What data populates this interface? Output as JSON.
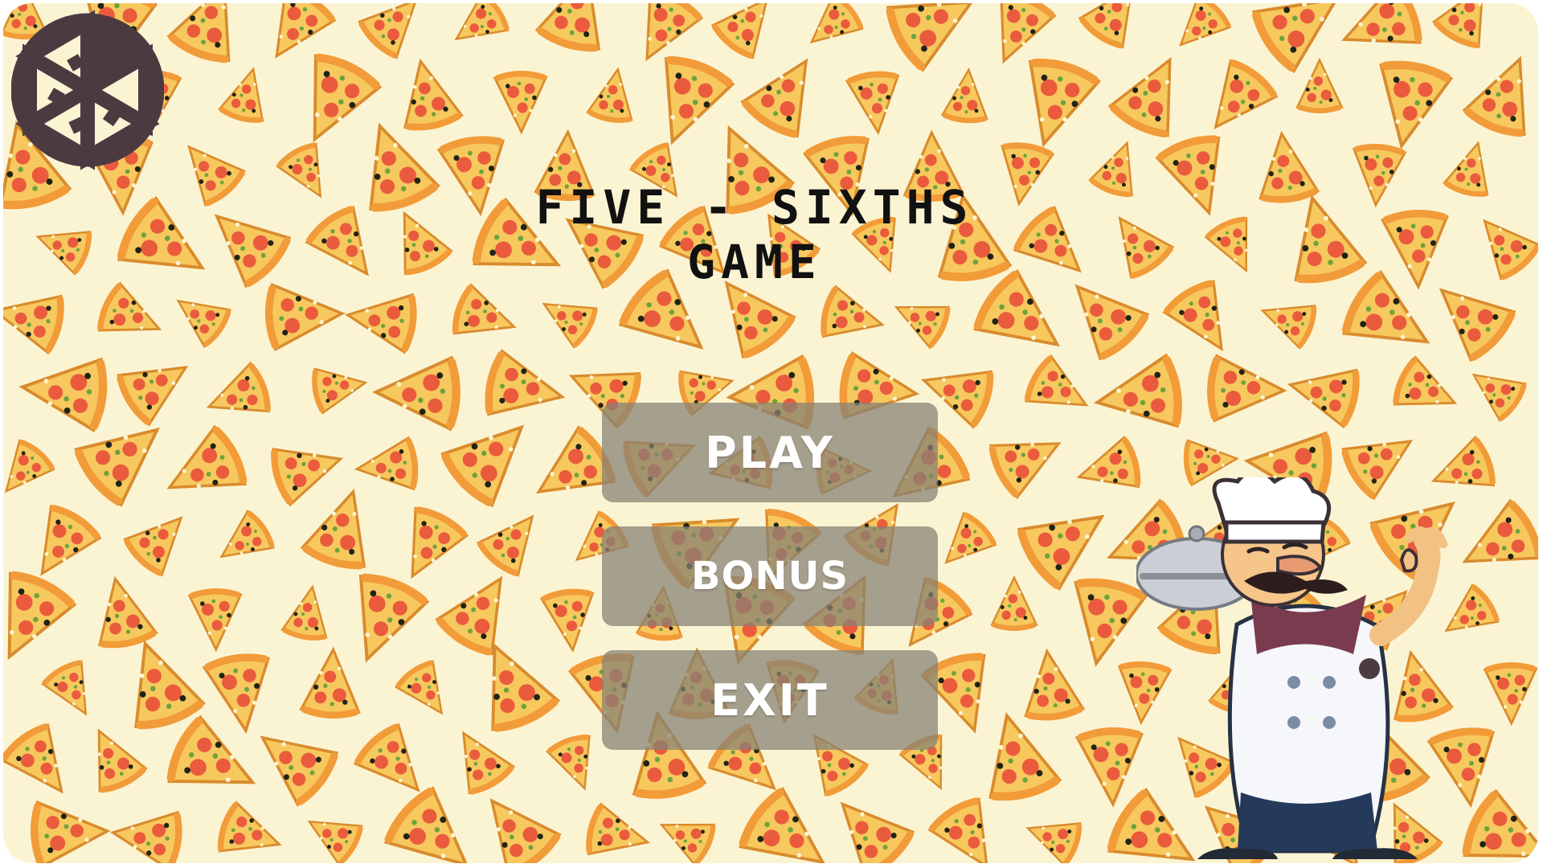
{
  "title": {
    "line1": "FIVE - SIXTHS",
    "line2": "GAME"
  },
  "menu": {
    "play": "PLAY",
    "bonus": "BONUS",
    "exit": "EXIT"
  },
  "icons": {
    "logo": "pizza-logo-icon",
    "chef": "chef-character-icon",
    "background": "pizza-slices-pattern"
  },
  "colors": {
    "background": "#fbf4d3",
    "logo": "#4b3b41",
    "button_fill": "#878274",
    "title": "#111111",
    "button_text": "#ffffff"
  }
}
